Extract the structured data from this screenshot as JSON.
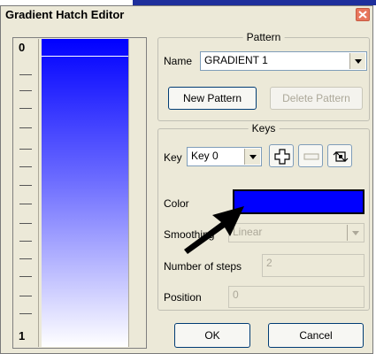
{
  "window": {
    "title": "Gradient Hatch Editor"
  },
  "gradient": {
    "top_key_label": "0",
    "bottom_key_label": "1",
    "start_color": "#0000ff",
    "end_color": "#ffffff"
  },
  "pattern": {
    "group_title": "Pattern",
    "name_label": "Name",
    "name_value": "GRADIENT 1",
    "new_button": "New Pattern",
    "delete_button": "Delete Pattern"
  },
  "keys": {
    "group_title": "Keys",
    "key_label": "Key",
    "key_value": "Key 0",
    "color_label": "Color",
    "color_value": "#0000ff",
    "smoothing_label": "Smoothing",
    "smoothing_value": "Linear",
    "steps_label": "Number of steps",
    "steps_value": "2",
    "position_label": "Position",
    "position_value": "0"
  },
  "buttons": {
    "ok": "OK",
    "cancel": "Cancel"
  }
}
